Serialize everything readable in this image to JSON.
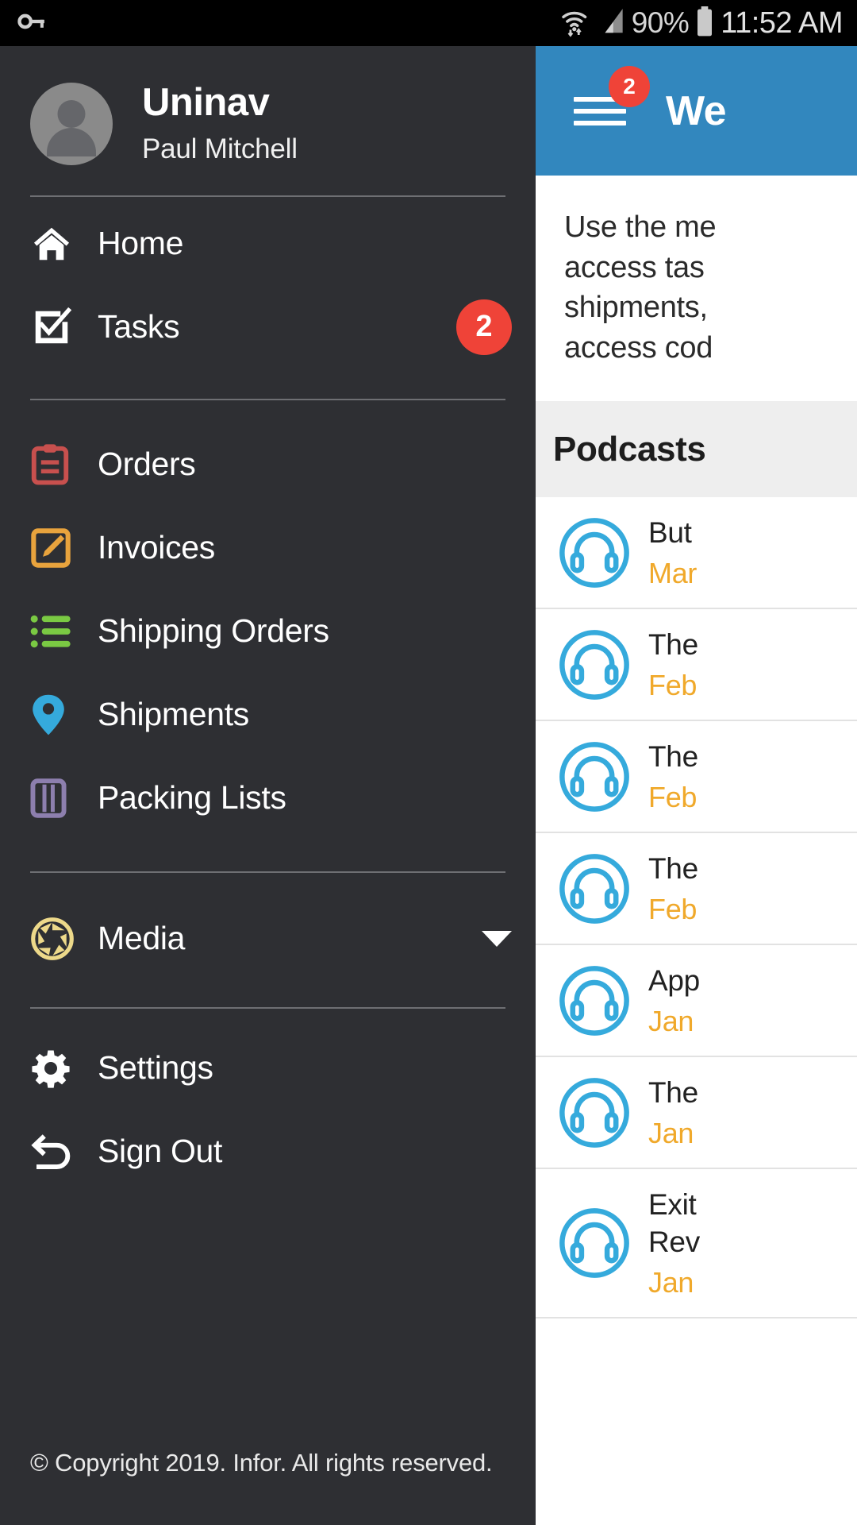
{
  "statusbar": {
    "key_icon": "key-icon",
    "wifi_icon": "wifi-icon",
    "signal_icon": "cell-signal-icon",
    "battery_percent": "90%",
    "battery_icon": "battery-icon",
    "time": "11:52 AM"
  },
  "drawer": {
    "app_title": "Uninav",
    "user_name": "Paul Mitchell",
    "avatar_icon": "user-avatar-icon",
    "items": [
      {
        "label": "Home",
        "icon": "home-icon",
        "color": "#ffffff",
        "badge": null
      },
      {
        "label": "Tasks",
        "icon": "checkbox-check-icon",
        "color": "#ffffff",
        "badge": "2"
      },
      {
        "label": "Orders",
        "icon": "clipboard-icon",
        "color": "#c8504e",
        "badge": null
      },
      {
        "label": "Invoices",
        "icon": "edit-square-icon",
        "color": "#e8a33d",
        "badge": null
      },
      {
        "label": "Shipping Orders",
        "icon": "bullet-list-icon",
        "color": "#7ac943",
        "badge": null
      },
      {
        "label": "Shipments",
        "icon": "map-pin-icon",
        "color": "#35aadc",
        "badge": null
      },
      {
        "label": "Packing Lists",
        "icon": "columns-icon",
        "color": "#8d7fae",
        "badge": null
      },
      {
        "label": "Media",
        "icon": "aperture-icon",
        "color": "#edd98a",
        "badge": null,
        "expandable": true,
        "caret_icon": "chevron-down-icon"
      },
      {
        "label": "Settings",
        "icon": "gear-icon",
        "color": "#ffffff",
        "badge": null
      },
      {
        "label": "Sign Out",
        "icon": "sign-out-arrow-icon",
        "color": "#ffffff",
        "badge": null
      }
    ],
    "copyright": "© Copyright 2019. Infor. All rights reserved."
  },
  "content": {
    "appbar": {
      "menu_icon": "hamburger-menu-icon",
      "menu_badge": "2",
      "title": "We",
      "background": "#3287be"
    },
    "intro_text": "Use the me\naccess tas\nshipments,\naccess cod",
    "section_title": "Podcasts",
    "podcast_icon": "headphones-circle-icon",
    "podcasts": [
      {
        "title": "But",
        "date": "Mar"
      },
      {
        "title": "The",
        "date": "Feb"
      },
      {
        "title": "The",
        "date": "Feb"
      },
      {
        "title": "The",
        "date": "Feb"
      },
      {
        "title": "App",
        "date": "Jan"
      },
      {
        "title": "The",
        "date": "Jan"
      },
      {
        "title": "Exit\nRev",
        "date": "Jan"
      }
    ]
  },
  "colors": {
    "drawer_bg": "#2e2f33",
    "accent_blue": "#3287be",
    "badge_red": "#ef4338",
    "date_orange": "#f0a92b",
    "section_gray": "#eeeeee"
  }
}
